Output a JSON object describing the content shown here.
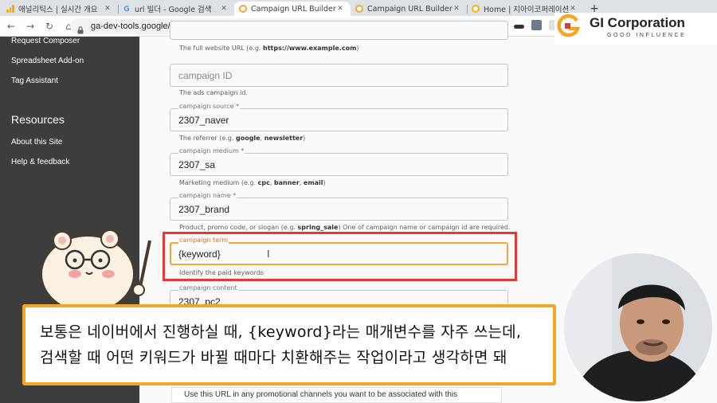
{
  "browser": {
    "tabs": [
      {
        "title": "애널리틱스 | 실시간 개요",
        "icon": "analytics-favicon",
        "active": false
      },
      {
        "title": "url 빌더 - Google 검색",
        "icon": "google-favicon",
        "active": false
      },
      {
        "title": "Campaign URL Builder",
        "icon": "ga-dev-tools-favicon",
        "active": true
      },
      {
        "title": "Campaign URL Builder",
        "icon": "ga-dev-tools-favicon",
        "active": false
      },
      {
        "title": "Home | 지아이코퍼레이션",
        "icon": "site-favicon",
        "active": false
      }
    ],
    "new_tab": "+",
    "close_glyph": "✕",
    "url": "ga-dev-tools.google/campaign-url-builder/"
  },
  "sidebar": {
    "links_top": [
      "Request Composer",
      "Spreadsheet Add-on",
      "Tag Assistant"
    ],
    "resources_heading": "Resources",
    "links_bottom": [
      "About this Site",
      "Help & feedback"
    ]
  },
  "form": {
    "website_help_prefix": "The full website URL (e.g. ",
    "website_help_bold": "https://www.example.com",
    "website_help_suffix": ")",
    "campaign_id": {
      "placeholder": "campaign ID",
      "help": "The ads campaign id."
    },
    "campaign_source": {
      "label": "campaign source *",
      "value": "2307_naver",
      "help_prefix": "The referrer (e.g. ",
      "help_b1": "google",
      "help_mid": ", ",
      "help_b2": "newsletter",
      "help_suffix": ")"
    },
    "campaign_medium": {
      "label": "campaign medium *",
      "value": "2307_sa",
      "help_prefix": "Marketing medium (e.g. ",
      "help_b1": "cpc",
      "help_mid1": ", ",
      "help_b2": "banner",
      "help_mid2": ", ",
      "help_b3": "email",
      "help_suffix": ")"
    },
    "campaign_name": {
      "label": "campaign name *",
      "value": "2307_brand",
      "help_prefix": "Product, promo code, or slogan (e.g. ",
      "help_b1": "spring_sale",
      "help_suffix": ") One of campaign name or campaign id are required."
    },
    "campaign_term": {
      "label": "campaign term",
      "value": "{keyword}",
      "help": "Identify the paid keywords"
    },
    "campaign_content": {
      "label": "campaign content",
      "value": "2307_pc2"
    },
    "bottom_text": "Use this URL in any promotional channels you want to be associated with this"
  },
  "caption": {
    "line1": "보통은 네이버에서 진행하실 때, {keyword}라는 매개변수를 자주 쓰는데,",
    "line2": "검색할 때 어떤 키워드가 바뀔 때마다 치환해주는 작업이라고 생각하면 돼"
  },
  "logo": {
    "name": "GI Corporation",
    "tagline": "GOOD INFLUENCE"
  },
  "colors": {
    "sidebar": "#3d3d3d",
    "focus": "#f4a63b",
    "highlight": "#e53935",
    "caption_border": "#f6a623"
  }
}
